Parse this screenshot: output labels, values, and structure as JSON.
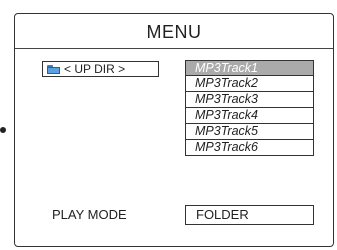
{
  "menu": {
    "title": "MENU",
    "up_dir_label": "< UP DIR >",
    "up_dir_icon": "folder-icon",
    "tracks": [
      {
        "label": "MP3Track1",
        "selected": true
      },
      {
        "label": "MP3Track2",
        "selected": false
      },
      {
        "label": "MP3Track3",
        "selected": false
      },
      {
        "label": "MP3Track4",
        "selected": false
      },
      {
        "label": "MP3Track5",
        "selected": false
      },
      {
        "label": "MP3Track6",
        "selected": false
      }
    ],
    "playmode_label": "PLAY MODE",
    "playmode_value": "FOLDER"
  },
  "colors": {
    "selected_bg": "#aaaaaa",
    "selected_text": "#ffffff",
    "folder_icon": "#5aa0e0"
  }
}
